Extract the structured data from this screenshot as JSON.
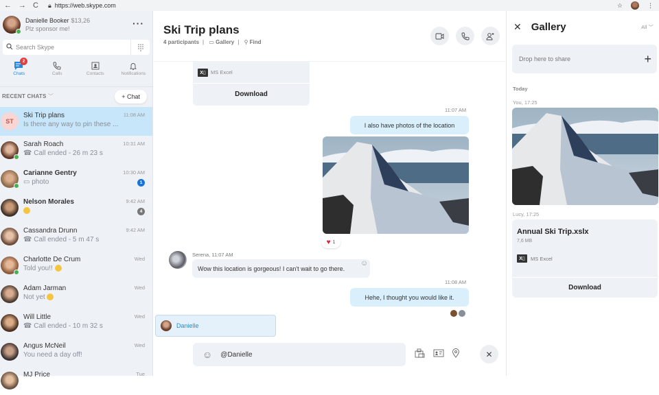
{
  "browser": {
    "url": "https://web.skype.com",
    "back_icon": "arrow-left-icon",
    "forward_icon": "arrow-right-icon",
    "reload_icon": "reload-icon",
    "lock_icon": "lock-icon",
    "star_icon": "star-icon",
    "menu_icon": "kebab-menu-icon"
  },
  "profile": {
    "name": "Danielle Booker",
    "credit": "$13,26",
    "mood": "Plz sponsor me!"
  },
  "search": {
    "placeholder": "Search Skype"
  },
  "nav_tabs": [
    {
      "label": "Chats",
      "icon": "chat-icon",
      "badge": "2",
      "active": true
    },
    {
      "label": "Calls",
      "icon": "phone-icon"
    },
    {
      "label": "Contacts",
      "icon": "contacts-icon"
    },
    {
      "label": "Notifications",
      "icon": "bell-icon"
    }
  ],
  "recent_chats": {
    "label": "RECENT CHATS",
    "new_chat_label": "+ Chat"
  },
  "chats": [
    {
      "name": "Ski Trip plans",
      "preview": "Is there any way to pin these ...",
      "time": "11:08 AM",
      "initials": "ST",
      "selected": true
    },
    {
      "name": "Sarah Roach",
      "preview": "Call ended - 26 m 23 s",
      "time": "10:31 AM",
      "online": true,
      "call": true
    },
    {
      "name": "Carianne Gentry",
      "preview": "photo",
      "time": "10:30 AM",
      "online": true,
      "bold": true,
      "unread": "1",
      "unread_color": "#1a73d9"
    },
    {
      "name": "Nelson Morales",
      "preview": "",
      "time": "9:42 AM",
      "bold": true,
      "unread": "4",
      "unread_color": "#777777"
    },
    {
      "name": "Cassandra Drunn",
      "preview": "Call ended - 5 m 47 s",
      "time": "9:42 AM",
      "call": true
    },
    {
      "name": "Charlotte De Crum",
      "preview": "Told you!!",
      "time": "Wed",
      "online": true
    },
    {
      "name": "Adam Jarman",
      "preview": "Not yet",
      "time": "Wed"
    },
    {
      "name": "Will Little",
      "preview": "Call ended - 10 m 32 s",
      "time": "Wed",
      "call": true
    },
    {
      "name": "Angus McNeil",
      "preview": "You need a day off!",
      "time": "Wed"
    },
    {
      "name": "MJ Price",
      "preview": "",
      "time": "Tue"
    }
  ],
  "conversation": {
    "title": "Ski Trip plans",
    "participants": "4 participants",
    "gallery_link": "Gallery",
    "find_link": "Find",
    "file_card": {
      "type": "MS Excel",
      "download": "Download"
    },
    "messages": [
      {
        "time": "11:07 AM",
        "text": "I also have photos of the location",
        "reaction_count": "1"
      },
      {
        "sender_time": "Serena, 11:07 AM",
        "text": "Wow this location is gorgeous! I can't wait to go there."
      },
      {
        "time": "11:08 AM",
        "text": "Hehe, I thought you would like it."
      }
    ],
    "mention_suggestion": "Danielle",
    "compose_value": "@Danielle"
  },
  "gallery": {
    "title": "Gallery",
    "filter": "All",
    "drop_label": "Drop here to share",
    "section": "Today",
    "photo_meta": "You, 17:25",
    "file_meta": "Lucy, 17:25",
    "file": {
      "name": "Annual Ski Trip.xslx",
      "size": "7,6 MB",
      "type": "MS Excel",
      "download": "Download"
    }
  }
}
